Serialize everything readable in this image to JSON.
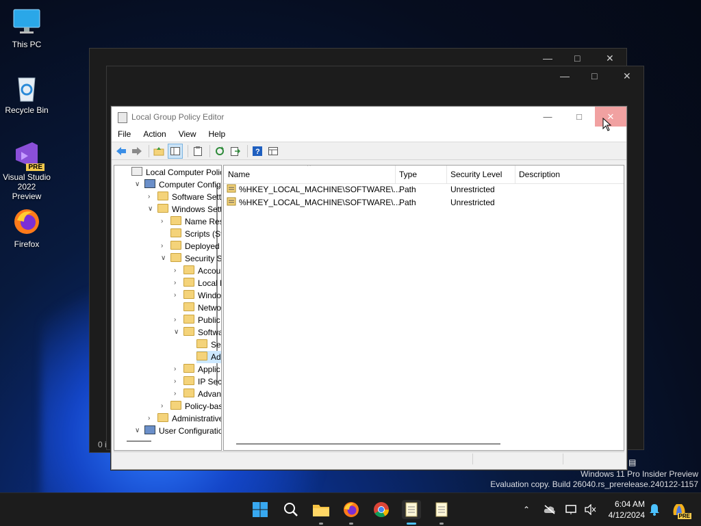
{
  "desktop": {
    "icons": [
      {
        "label": "This PC"
      },
      {
        "label": "Recycle Bin"
      },
      {
        "label": "Visual Studio 2022 Preview",
        "badge": "PRE"
      },
      {
        "label": "Firefox"
      }
    ]
  },
  "background_windows": {
    "status_fragment": "0 i"
  },
  "window": {
    "title": "Local Group Policy Editor",
    "menu": [
      "File",
      "Action",
      "View",
      "Help"
    ],
    "tree": [
      {
        "label": "Local Computer Polic",
        "level": 0,
        "expander": ""
      },
      {
        "label": "Computer Config",
        "level": 1,
        "expander": "open"
      },
      {
        "label": "Software Setti",
        "level": 2,
        "expander": "closed"
      },
      {
        "label": "Windows Sett",
        "level": 2,
        "expander": "open"
      },
      {
        "label": "Name Res",
        "level": 3,
        "expander": "closed"
      },
      {
        "label": "Scripts (Sta",
        "level": 3,
        "expander": ""
      },
      {
        "label": "Deployed",
        "level": 3,
        "expander": "closed"
      },
      {
        "label": "Security Se",
        "level": 3,
        "expander": "open"
      },
      {
        "label": "Accou",
        "level": 4,
        "expander": "closed"
      },
      {
        "label": "Local F",
        "level": 4,
        "expander": "closed"
      },
      {
        "label": "Windo",
        "level": 4,
        "expander": "closed"
      },
      {
        "label": "Netwo",
        "level": 4,
        "expander": ""
      },
      {
        "label": "Public",
        "level": 4,
        "expander": "closed"
      },
      {
        "label": "Softwa",
        "level": 4,
        "expander": "open"
      },
      {
        "label": "Sec",
        "level": 5,
        "expander": ""
      },
      {
        "label": "Ad",
        "level": 5,
        "expander": "",
        "selected": true
      },
      {
        "label": "Applic",
        "level": 4,
        "expander": "closed"
      },
      {
        "label": "IP Secu",
        "level": 4,
        "expander": "closed"
      },
      {
        "label": "Advan",
        "level": 4,
        "expander": "closed"
      },
      {
        "label": "Policy-bas",
        "level": 3,
        "expander": "closed"
      },
      {
        "label": "Administrative",
        "level": 2,
        "expander": "closed"
      },
      {
        "label": "User Configuratio",
        "level": 1,
        "expander": "open"
      }
    ],
    "columns": [
      "Name",
      "Type",
      "Security Level",
      "Description"
    ],
    "rows": [
      {
        "name": "%HKEY_LOCAL_MACHINE\\SOFTWARE\\...",
        "type": "Path",
        "level": "Unrestricted",
        "description": ""
      },
      {
        "name": "%HKEY_LOCAL_MACHINE\\SOFTWARE\\...",
        "type": "Path",
        "level": "Unrestricted",
        "description": ""
      }
    ]
  },
  "watermark": {
    "line1": "Windows 11 Pro Insider Preview",
    "line2": "Evaluation copy. Build 26040.rs_prerelease.240122-1157"
  },
  "taskbar": {
    "time": "6:04 AM",
    "date": "4/12/2024",
    "copilot_badge": "PRE"
  },
  "colors": {
    "accent": "#0067c0",
    "close_hover": "#f1a1a1",
    "folder": "#f4d37a"
  }
}
